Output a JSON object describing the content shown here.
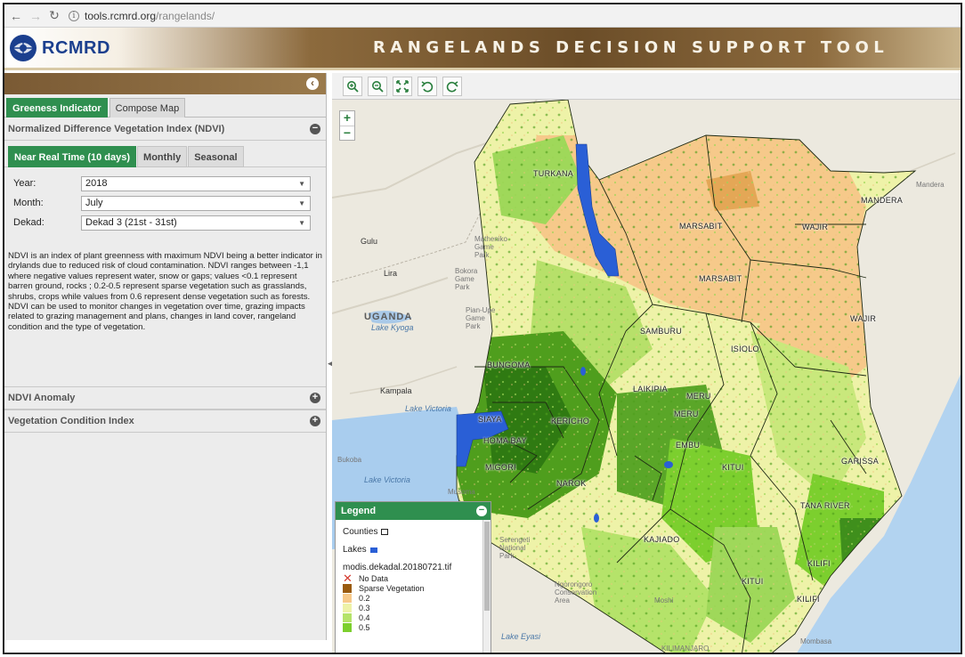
{
  "browser": {
    "url_host": "tools.rcmrd.org",
    "url_path": "/rangelands/"
  },
  "header": {
    "logo_text": "RCMRD",
    "title": "RANGELANDS DECISION SUPPORT TOOL"
  },
  "left_panel": {
    "tabs": [
      {
        "label": "Greeness Indicator",
        "active": true
      },
      {
        "label": "Compose Map",
        "active": false
      }
    ],
    "ndvi_section": {
      "title": "Normalized Difference Vegetation Index (NDVI)",
      "subtabs": [
        {
          "label": "Near Real Time (10 days)",
          "active": true
        },
        {
          "label": "Monthly",
          "active": false
        },
        {
          "label": "Seasonal",
          "active": false
        }
      ],
      "fields": {
        "year": {
          "label": "Year:",
          "value": "2018"
        },
        "month": {
          "label": "Month:",
          "value": "July"
        },
        "dekad": {
          "label": "Dekad:",
          "value": "Dekad 3 (21st - 31st)"
        }
      },
      "description": "NDVI is an index of plant greenness with maximum NDVI being a better indicator in drylands due to reduced risk of cloud contamination. NDVI ranges between -1,1 where negative values represent water, snow or gaps; values <0.1 represent barren ground, rocks ; 0.2-0.5 represent sparse vegetation such as grasslands, shrubs, crops while values from 0.6 represent dense vegetation such as forests. NDVI can be used to monitor changes in vegetation over time, grazing impacts related to grazing management and plans, changes in land cover, rangeland condition and the type of vegetation."
    },
    "anomaly_section": {
      "title": "NDVI Anomaly"
    },
    "vci_section": {
      "title": "Vegetation Condition Index"
    }
  },
  "map": {
    "labels": {
      "countries": [
        "UGANDA"
      ],
      "counties": [
        "TURKANA",
        "MARSABIT",
        "MARSABIT",
        "MANDERA",
        "WAJIR",
        "WAJIR",
        "SAMBURU",
        "ISIOLO",
        "BUNGOMA",
        "LAIKIPIA",
        "MERU",
        "MERU",
        "EMBU",
        "KERICHO",
        "HOMA BAY",
        "MIGORI",
        "NAROK",
        "KITUI",
        "KAJIADO",
        "KITUI",
        "GARISSA",
        "TANA RIVER",
        "KILIFI",
        "KILIFI",
        "SIAYA"
      ],
      "places": [
        "Gulu",
        "Lira",
        "Kampala",
        "Bukoba",
        "Musoma",
        "Mandera",
        "Matheniko Game Park",
        "Bokora Game Park",
        "Pian-Upe Game Park",
        "Serengeti National Park",
        "Ngorongoro Conservation Area",
        "Moshi",
        "Mombasa",
        "KILIMANJARO"
      ],
      "water": [
        "Lake Kyoga",
        "Lake Victoria",
        "Lake Victoria",
        "Lake Eyasi"
      ]
    }
  },
  "legend": {
    "title": "Legend",
    "counties_label": "Counties",
    "lakes_label": "Lakes",
    "layer_name": "modis.dekadal.20180721.tif",
    "classes": [
      {
        "label": "No Data",
        "color": "#d43a2f",
        "kind": "x"
      },
      {
        "label": "Sparse Vegetation",
        "color": "#9a5b0f",
        "kind": "box"
      },
      {
        "label": "0.2",
        "color": "#f7c98a",
        "kind": "box"
      },
      {
        "label": "0.3",
        "color": "#eef2a8",
        "kind": "box"
      },
      {
        "label": "0.4",
        "color": "#b5e36a",
        "kind": "box"
      },
      {
        "label": "0.5",
        "color": "#7ccf2e",
        "kind": "box"
      }
    ]
  },
  "colors": {
    "brand_green": "#2f8f4f",
    "header_brown": "#6b4d28",
    "lake_blue": "#2a5fd6"
  }
}
